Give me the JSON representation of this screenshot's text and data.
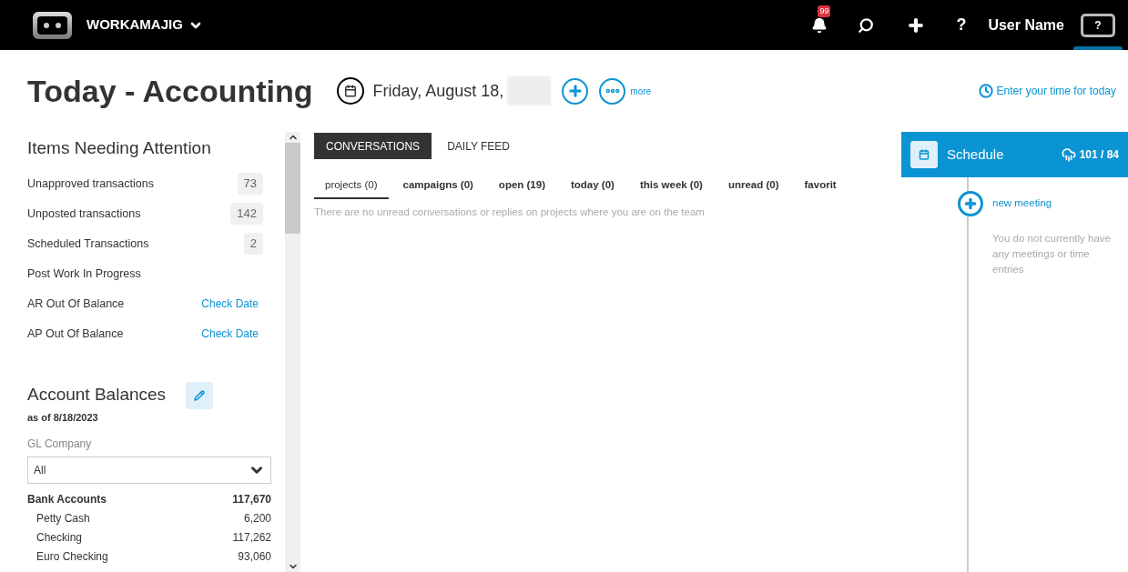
{
  "topbar": {
    "brand": "WORKAMAJIG",
    "notification_count": "99",
    "help": "?",
    "user_name": "User Name",
    "avatar_text": "?"
  },
  "header": {
    "title": "Today - Accounting",
    "date": "Friday, August 18,",
    "more": "more",
    "time_link": "Enter your time for today"
  },
  "attention": {
    "title": "Items Needing Attention",
    "items": [
      {
        "label": "Unapproved transactions",
        "kind": "count",
        "value": "73"
      },
      {
        "label": "Unposted transactions",
        "kind": "count",
        "value": "142"
      },
      {
        "label": "Scheduled Transactions",
        "kind": "count",
        "value": "2"
      },
      {
        "label": "Post Work In Progress",
        "kind": "plain"
      },
      {
        "label": "AR Out Of Balance",
        "kind": "link",
        "value": "Check Date"
      },
      {
        "label": "AP Out Of Balance",
        "kind": "link",
        "value": "Check Date"
      }
    ]
  },
  "balances": {
    "title": "Account Balances",
    "as_of": "as of 8/18/2023",
    "company_label": "GL Company",
    "company_value": "All",
    "groups": [
      {
        "name": "Bank Accounts",
        "total": "117,670",
        "children": [
          {
            "name": "Petty Cash",
            "value": "6,200"
          },
          {
            "name": "Checking",
            "value": "117,262"
          },
          {
            "name": "Euro Checking",
            "value": "93,060"
          }
        ]
      }
    ]
  },
  "tabs": [
    {
      "label": "CONVERSATIONS",
      "selected": true
    },
    {
      "label": "DAILY FEED",
      "selected": false
    }
  ],
  "filters": [
    {
      "label": "projects (0)",
      "selected": true
    },
    {
      "label": "campaigns (0)",
      "selected": false
    },
    {
      "label": "open (19)",
      "selected": false
    },
    {
      "label": "today (0)",
      "selected": false
    },
    {
      "label": "this week (0)",
      "selected": false
    },
    {
      "label": "unread (0)",
      "selected": false
    },
    {
      "label": "favorit",
      "selected": false
    }
  ],
  "empty_message": "There are no unread conversations or replies on projects where you are on the team",
  "schedule": {
    "title": "Schedule",
    "stats": "101 / 84",
    "new_meeting": "new meeting",
    "empty_message": "You do not currently have any meetings or time entries"
  }
}
